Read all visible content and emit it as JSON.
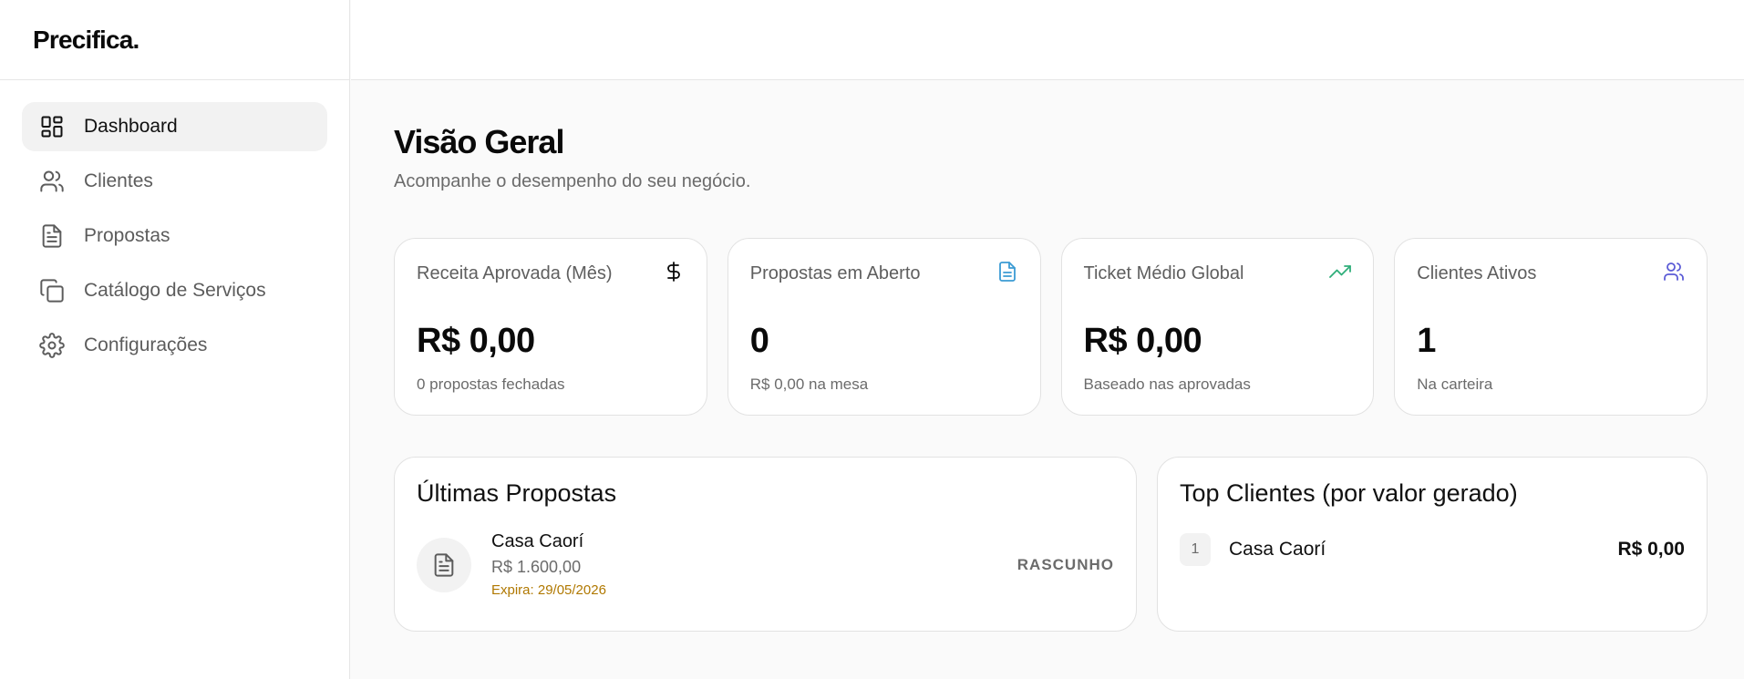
{
  "brand": "Precifica.",
  "sidebar": {
    "items": [
      {
        "label": "Dashboard",
        "icon": "dashboard-icon",
        "active": true
      },
      {
        "label": "Clientes",
        "icon": "users-icon"
      },
      {
        "label": "Propostas",
        "icon": "document-icon"
      },
      {
        "label": "Catálogo de Serviços",
        "icon": "copy-icon"
      },
      {
        "label": "Configurações",
        "icon": "gear-icon"
      }
    ]
  },
  "header": {
    "title": "Visão Geral",
    "subtitle": "Acompanhe o desempenho do seu negócio."
  },
  "stats": [
    {
      "label": "Receita Aprovada (Mês)",
      "value": "R$ 0,00",
      "sub": "0 propostas fechadas",
      "icon": "dollar-icon",
      "color": "#0a0a0a"
    },
    {
      "label": "Propostas em Aberto",
      "value": "0",
      "sub": "R$ 0,00 na mesa",
      "icon": "document-icon",
      "color": "#3b9bd4"
    },
    {
      "label": "Ticket Médio Global",
      "value": "R$ 0,00",
      "sub": "Baseado nas aprovadas",
      "icon": "trending-up-icon",
      "color": "#2fae7a"
    },
    {
      "label": "Clientes Ativos",
      "value": "1",
      "sub": "Na carteira",
      "icon": "users-icon",
      "color": "#5b5bd6"
    }
  ],
  "recent": {
    "title": "Últimas Propostas",
    "items": [
      {
        "client": "Casa Caorí",
        "value": "R$ 1.600,00",
        "expires": "Expira: 29/05/2026",
        "status": "RASCUNHO"
      }
    ]
  },
  "top_clients": {
    "title": "Top Clientes (por valor gerado)",
    "items": [
      {
        "rank": "1",
        "name": "Casa Caorí",
        "value": "R$ 0,00"
      }
    ]
  }
}
